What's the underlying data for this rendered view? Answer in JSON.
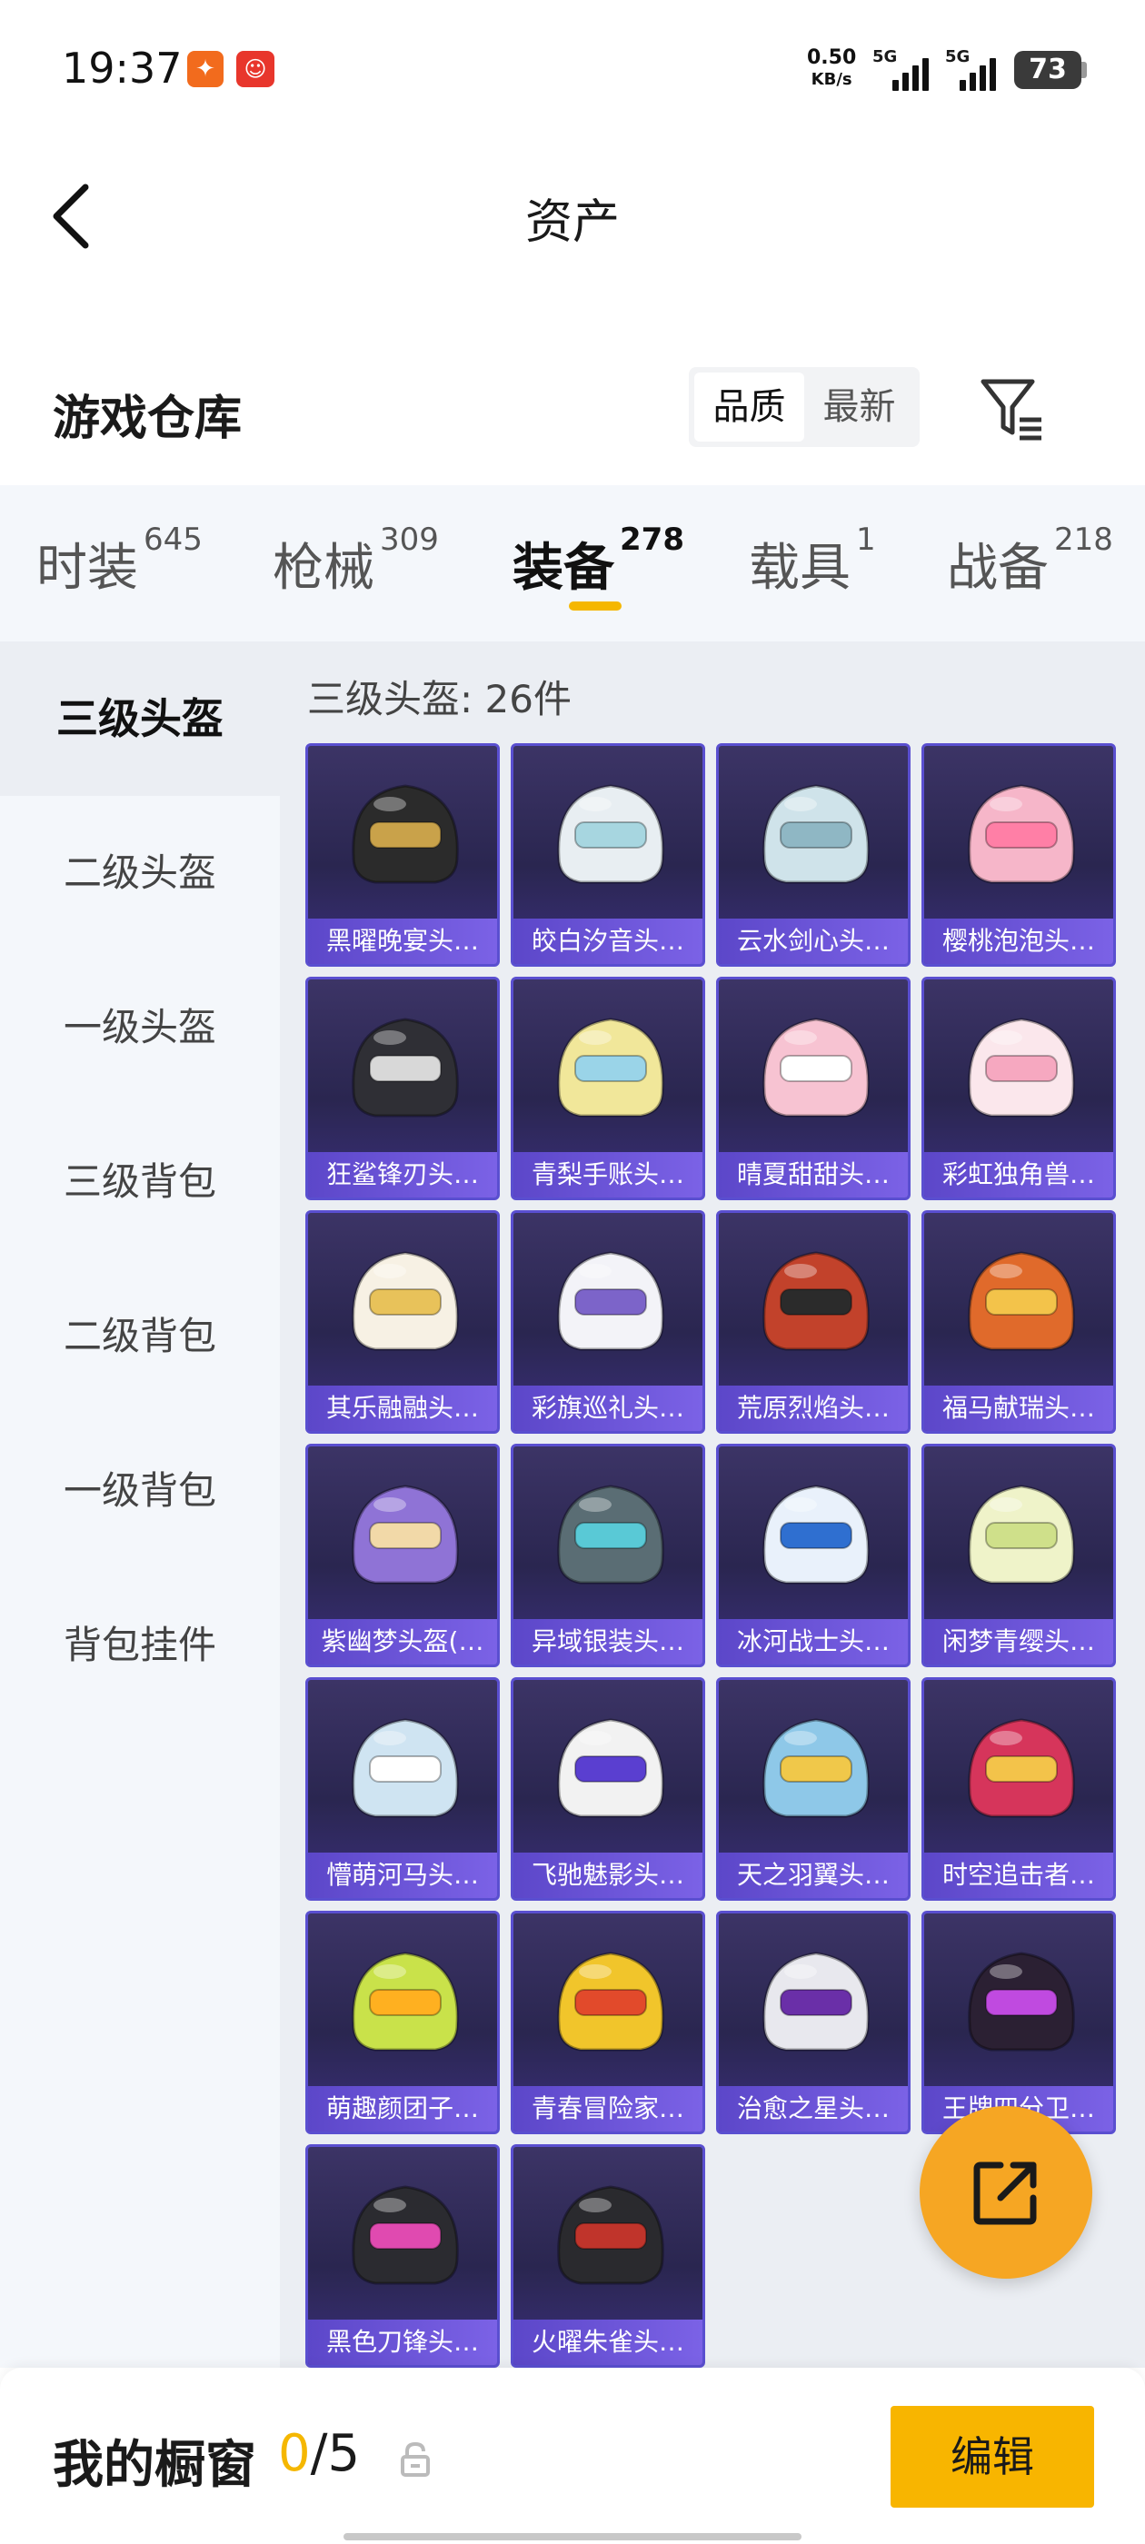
{
  "status_bar": {
    "time": "19:37",
    "net_speed_value": "0.50",
    "net_speed_unit": "KB/s",
    "sim1": "5G",
    "sim2": "5G",
    "battery": "73"
  },
  "header": {
    "title": "资产"
  },
  "warehouse": {
    "title": "游戏仓库",
    "sort_options": [
      "品质",
      "最新"
    ],
    "sort_selected": "品质"
  },
  "tabs": [
    {
      "label": "时装",
      "count": "645"
    },
    {
      "label": "枪械",
      "count": "309"
    },
    {
      "label": "装备",
      "count": "278"
    },
    {
      "label": "载具",
      "count": "1"
    },
    {
      "label": "战备",
      "count": "218"
    }
  ],
  "active_tab": "装备",
  "sidebar": {
    "items": [
      "三级头盔",
      "二级头盔",
      "一级头盔",
      "三级背包",
      "二级背包",
      "一级背包",
      "背包挂件"
    ],
    "active": "三级头盔"
  },
  "list_title": "三级头盔: 26件",
  "items": [
    {
      "name": "黑曜晚宴头…",
      "color": "#2b2b2b",
      "accent": "#c9a24a"
    },
    {
      "name": "皎白汐音头…",
      "color": "#e8eef2",
      "accent": "#a7d6e0"
    },
    {
      "name": "云水剑心头…",
      "color": "#cfe3ea",
      "accent": "#8fb7c4"
    },
    {
      "name": "樱桃泡泡头…",
      "color": "#f6b6c9",
      "accent": "#ff7fa6"
    },
    {
      "name": "狂鲨锋刃头…",
      "color": "#2f2f35",
      "accent": "#d8d8d8"
    },
    {
      "name": "青梨手账头…",
      "color": "#f1e79a",
      "accent": "#9ad4e8"
    },
    {
      "name": "晴夏甜甜头…",
      "color": "#f7c3d2",
      "accent": "#ffffff"
    },
    {
      "name": "彩虹独角兽…",
      "color": "#fbe7ec",
      "accent": "#f6a8c0"
    },
    {
      "name": "其乐融融头…",
      "color": "#f7f1e4",
      "accent": "#e8c25a"
    },
    {
      "name": "彩旗巡礼头…",
      "color": "#f3f3f8",
      "accent": "#7c64c9"
    },
    {
      "name": "荒原烈焰头…",
      "color": "#c2422b",
      "accent": "#2b2b2b"
    },
    {
      "name": "福马献瑞头…",
      "color": "#e06a2b",
      "accent": "#f3c34a"
    },
    {
      "name": "紫幽梦头盔(…",
      "color": "#8f73d6",
      "accent": "#f2d9a8"
    },
    {
      "name": "异域银装头…",
      "color": "#5a6d74",
      "accent": "#59c9d6"
    },
    {
      "name": "冰河战士头…",
      "color": "#e9f1fb",
      "accent": "#2f6fd0"
    },
    {
      "name": "闲梦青缨头…",
      "color": "#eff3c9",
      "accent": "#cfe08a"
    },
    {
      "name": "懵萌河马头…",
      "color": "#cfe4f2",
      "accent": "#ffffff"
    },
    {
      "name": "飞驰魅影头…",
      "color": "#f2f2f2",
      "accent": "#5a3fd0"
    },
    {
      "name": "天之羽翼头…",
      "color": "#8ec8e8",
      "accent": "#f0c84a"
    },
    {
      "name": "时空追击者…",
      "color": "#d6355b",
      "accent": "#f3c34a"
    },
    {
      "name": "萌趣颜团子…",
      "color": "#c9e24a",
      "accent": "#ffb020"
    },
    {
      "name": "青春冒险家…",
      "color": "#f1c52b",
      "accent": "#e24a2b"
    },
    {
      "name": "治愈之星头…",
      "color": "#e8e8ee",
      "accent": "#6a2fa8"
    },
    {
      "name": "王牌四分卫…",
      "color": "#2b2033",
      "accent": "#c04ae0"
    },
    {
      "name": "黑色刀锋头…",
      "color": "#2b2b30",
      "accent": "#e04ab0"
    },
    {
      "name": "火曜朱雀头…",
      "color": "#2a2a2e",
      "accent": "#c0342b"
    }
  ],
  "bottom": {
    "title": "我的橱窗",
    "current": "0",
    "separator": "/5",
    "edit_label": "编辑"
  },
  "colors": {
    "accent_yellow": "#f5b700",
    "card_border": "#5a4fd0",
    "card_bg": "#2a2650",
    "fab": "#f6a623"
  }
}
